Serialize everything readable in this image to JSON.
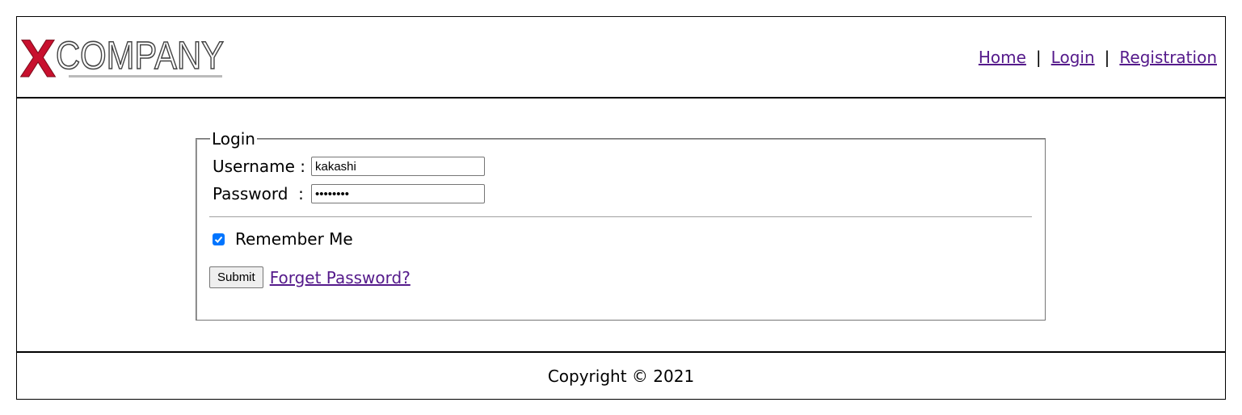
{
  "header": {
    "logo_text": "COMPANY",
    "logo_mark": "X",
    "nav": [
      {
        "label": "Home"
      },
      {
        "label": "Login"
      },
      {
        "label": "Registration"
      }
    ],
    "separator": "|"
  },
  "login_form": {
    "legend": "Login",
    "username_label": "Username :",
    "username_value": "kakashi",
    "password_label": "Password  :",
    "password_value": "••••••••",
    "remember_label": "Remember Me",
    "remember_checked": true,
    "submit_label": "Submit",
    "forgot_label": "Forget Password?"
  },
  "footer": {
    "copyright": "Copyright © 2021"
  },
  "colors": {
    "logo_red": "#c8102e",
    "link": "#551a8b",
    "checkbox": "#0075ff"
  }
}
